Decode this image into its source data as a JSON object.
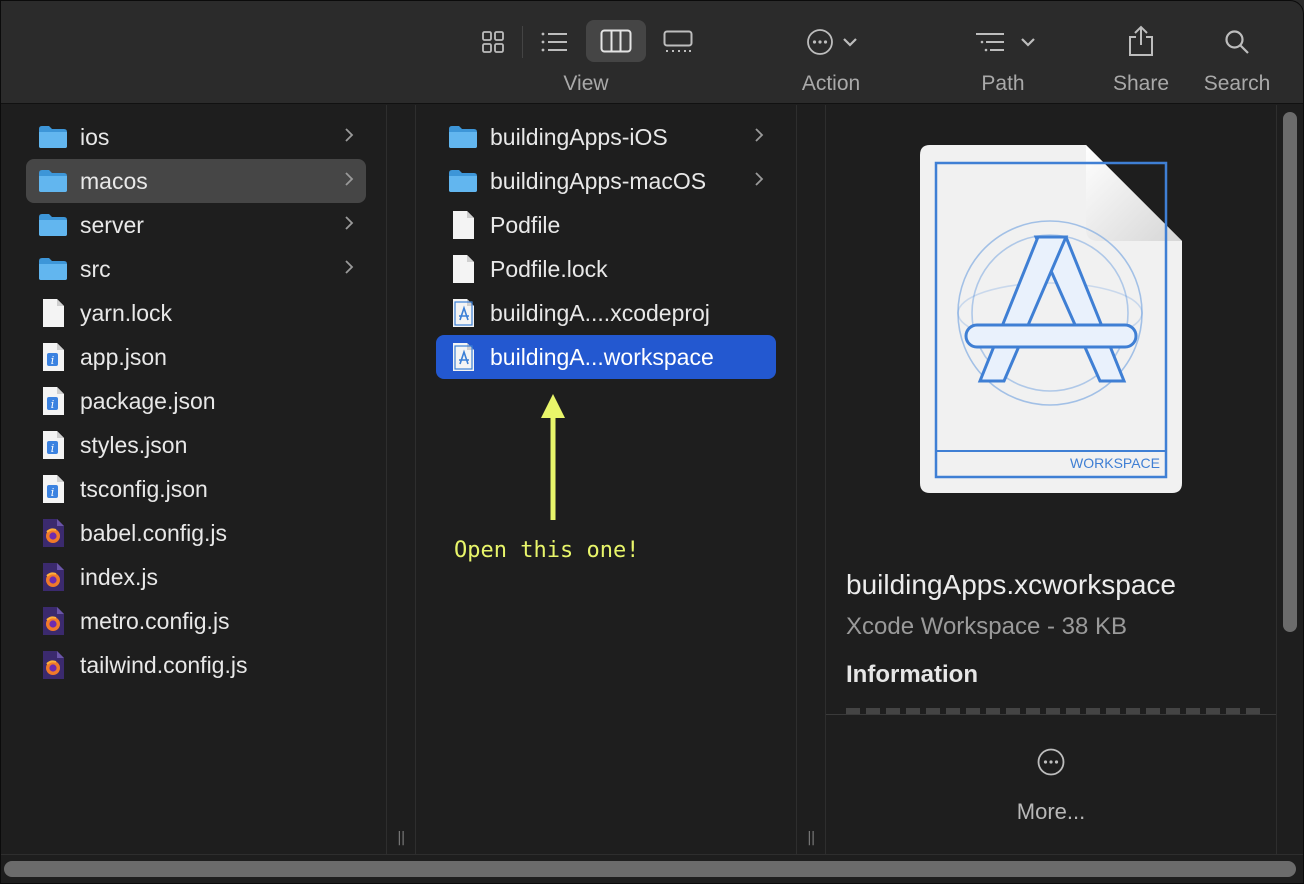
{
  "toolbar": {
    "view_label": "View",
    "action_label": "Action",
    "path_label": "Path",
    "share_label": "Share",
    "search_label": "Search",
    "view_modes": [
      "icon-view",
      "list-view",
      "column-view",
      "gallery-view"
    ],
    "selected_view_mode": "column-view"
  },
  "column1": {
    "items": [
      {
        "label": "ios",
        "kind": "folder",
        "has_children": true
      },
      {
        "label": "macos",
        "kind": "folder",
        "has_children": true,
        "selected": true
      },
      {
        "label": "server",
        "kind": "folder",
        "has_children": true
      },
      {
        "label": "src",
        "kind": "folder",
        "has_children": true
      },
      {
        "label": "yarn.lock",
        "kind": "document"
      },
      {
        "label": "app.json",
        "kind": "json"
      },
      {
        "label": "package.json",
        "kind": "json"
      },
      {
        "label": "styles.json",
        "kind": "json"
      },
      {
        "label": "tsconfig.json",
        "kind": "json"
      },
      {
        "label": "babel.config.js",
        "kind": "js"
      },
      {
        "label": "index.js",
        "kind": "js"
      },
      {
        "label": "metro.config.js",
        "kind": "js"
      },
      {
        "label": "tailwind.config.js",
        "kind": "js"
      }
    ]
  },
  "column2": {
    "items": [
      {
        "label": "buildingApps-iOS",
        "kind": "folder",
        "has_children": true
      },
      {
        "label": "buildingApps-macOS",
        "kind": "folder",
        "has_children": true
      },
      {
        "label": "Podfile",
        "kind": "document"
      },
      {
        "label": "Podfile.lock",
        "kind": "document"
      },
      {
        "label": "buildingA....xcodeproj",
        "kind": "xcode"
      },
      {
        "label": "buildingA...workspace",
        "kind": "xcode",
        "selected": true
      }
    ]
  },
  "annotation": {
    "text": "Open this one!",
    "color": "#e8f56a"
  },
  "preview": {
    "badge": "WORKSPACE",
    "file_name": "buildingApps.xcworkspace",
    "file_kind": "Xcode Workspace - 38 KB",
    "section_title": "Information",
    "more_label": "More..."
  },
  "colors": {
    "selection_blue": "#2358d0",
    "selection_grey": "#464646",
    "folder_blue": "#5fb6f0",
    "background": "#1e1e1e"
  }
}
